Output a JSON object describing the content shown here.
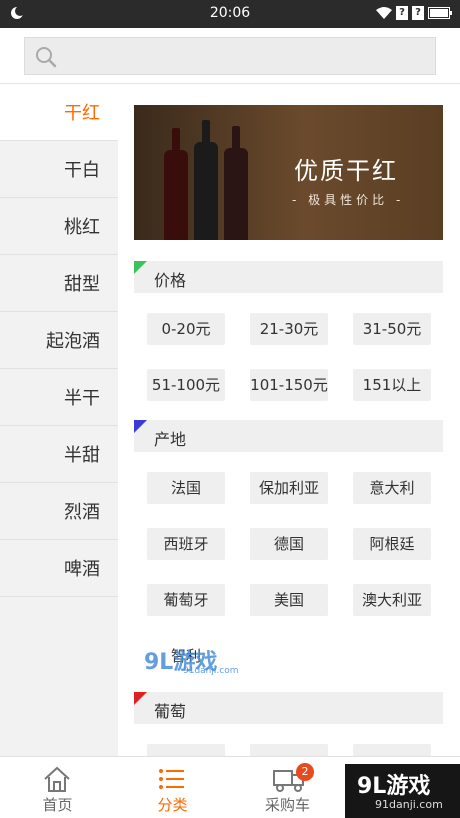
{
  "status": {
    "time": "20:06"
  },
  "search": {
    "placeholder": ""
  },
  "sidebar": {
    "items": [
      {
        "label": "干红"
      },
      {
        "label": "干白"
      },
      {
        "label": "桃红"
      },
      {
        "label": "甜型"
      },
      {
        "label": "起泡酒"
      },
      {
        "label": "半干"
      },
      {
        "label": "半甜"
      },
      {
        "label": "烈酒"
      },
      {
        "label": "啤酒"
      }
    ],
    "active_index": 0
  },
  "banner": {
    "title": "优质干红",
    "subtitle": "- 极具性价比 -"
  },
  "sections": {
    "price": {
      "title": "价格",
      "flag_color": "#3cc35b",
      "tags": [
        "0-20元",
        "21-30元",
        "31-50元",
        "51-100元",
        "101-150元",
        "151以上"
      ]
    },
    "origin": {
      "title": "产地",
      "flag_color": "#3b3bd9",
      "tags": [
        "法国",
        "保加利亚",
        "意大利",
        "西班牙",
        "德国",
        "阿根廷",
        "葡萄牙",
        "美国",
        "澳大利亚",
        "智利"
      ]
    },
    "grape": {
      "title": "葡萄",
      "flag_color": "#e02020"
    }
  },
  "tabbar": {
    "items": [
      {
        "label": "首页",
        "icon": "home-icon"
      },
      {
        "label": "分类",
        "icon": "category-list-icon"
      },
      {
        "label": "采购车",
        "icon": "truck-icon",
        "badge": "2"
      }
    ],
    "active_index": 1
  },
  "watermark": {
    "corner_big": "9L游戏",
    "corner_small": "91danji.com",
    "mid": "9L游戏",
    "mid_small": "91danji.com"
  },
  "colors": {
    "accent": "#ff6a00",
    "sidebar_bg": "#f2f2f2",
    "tag_bg": "#efefef"
  }
}
